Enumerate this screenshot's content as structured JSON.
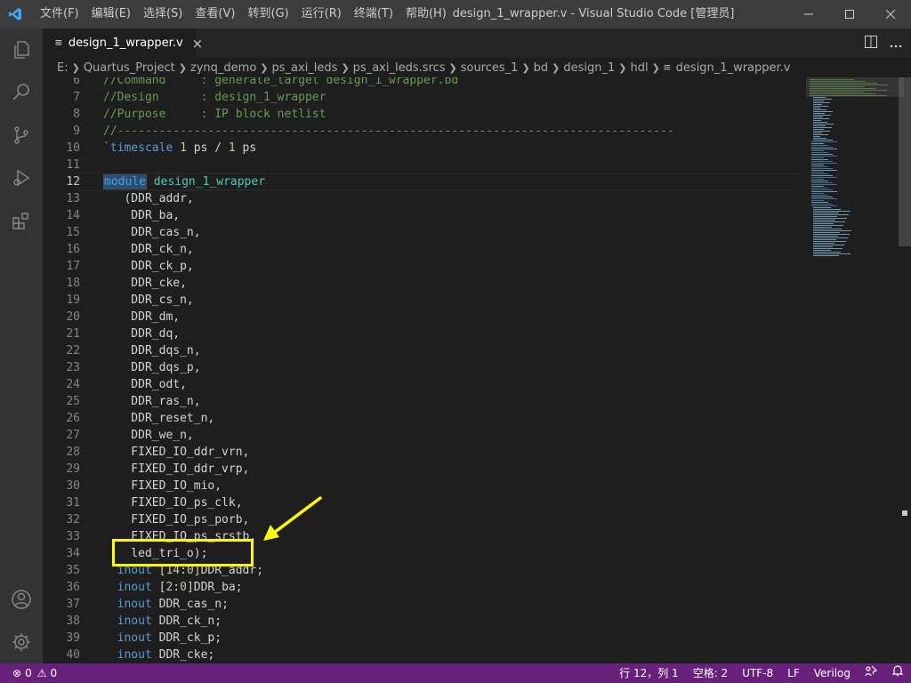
{
  "titlebar": {
    "menu": [
      "文件(F)",
      "编辑(E)",
      "选择(S)",
      "查看(V)",
      "转到(G)",
      "运行(R)",
      "终端(T)",
      "帮助(H)"
    ],
    "window_title": "design_1_wrapper.v - Visual Studio Code [管理员]"
  },
  "tab": {
    "label": "design_1_wrapper.v",
    "icon_text": "≡"
  },
  "breadcrumb": [
    "E:",
    "Quartus_Project",
    "zynq_demo",
    "ps_axi_leds",
    "ps_axi_leds.srcs",
    "sources_1",
    "bd",
    "design_1",
    "hdl",
    "design_1_wrapper.v"
  ],
  "editor": {
    "current_line": 12,
    "lines": [
      {
        "n": "6",
        "t": "//Command     : generate_target design_1_wrapper.bd"
      },
      {
        "n": "7",
        "t": "//Design      : design_1_wrapper"
      },
      {
        "n": "8",
        "t": "//Purpose     : IP block netlist"
      },
      {
        "n": "9",
        "t": "//--------------------------------------------------------------------------------"
      },
      {
        "n": "10",
        "t": "`timescale 1 ps / 1 ps"
      },
      {
        "n": "11",
        "t": ""
      },
      {
        "n": "12",
        "t": "module design_1_wrapper"
      },
      {
        "n": "13",
        "t": "   (DDR_addr,"
      },
      {
        "n": "14",
        "t": "    DDR_ba,"
      },
      {
        "n": "15",
        "t": "    DDR_cas_n,"
      },
      {
        "n": "16",
        "t": "    DDR_ck_n,"
      },
      {
        "n": "17",
        "t": "    DDR_ck_p,"
      },
      {
        "n": "18",
        "t": "    DDR_cke,"
      },
      {
        "n": "19",
        "t": "    DDR_cs_n,"
      },
      {
        "n": "20",
        "t": "    DDR_dm,"
      },
      {
        "n": "21",
        "t": "    DDR_dq,"
      },
      {
        "n": "22",
        "t": "    DDR_dqs_n,"
      },
      {
        "n": "23",
        "t": "    DDR_dqs_p,"
      },
      {
        "n": "24",
        "t": "    DDR_odt,"
      },
      {
        "n": "25",
        "t": "    DDR_ras_n,"
      },
      {
        "n": "26",
        "t": "    DDR_reset_n,"
      },
      {
        "n": "27",
        "t": "    DDR_we_n,"
      },
      {
        "n": "28",
        "t": "    FIXED_IO_ddr_vrn,"
      },
      {
        "n": "29",
        "t": "    FIXED_IO_ddr_vrp,"
      },
      {
        "n": "30",
        "t": "    FIXED_IO_mio,"
      },
      {
        "n": "31",
        "t": "    FIXED_IO_ps_clk,"
      },
      {
        "n": "32",
        "t": "    FIXED_IO_ps_porb,"
      },
      {
        "n": "33",
        "t": "    FIXED_IO_ps_srstb,"
      },
      {
        "n": "34",
        "t": "    led_tri_o);"
      },
      {
        "n": "35",
        "t": "  inout [14:0]DDR_addr;"
      },
      {
        "n": "36",
        "t": "  inout [2:0]DDR_ba;"
      },
      {
        "n": "37",
        "t": "  inout DDR_cas_n;"
      },
      {
        "n": "38",
        "t": "  inout DDR_ck_n;"
      },
      {
        "n": "39",
        "t": "  inout DDR_ck_p;"
      },
      {
        "n": "40",
        "t": "  inout DDR_cke;"
      }
    ]
  },
  "statusbar": {
    "errors": "0",
    "warnings": "0",
    "position": "行 12，列 1",
    "spaces": "空格: 2",
    "encoding": "UTF-8",
    "eol": "LF",
    "language": "Verilog"
  },
  "colors": {
    "statusbar": "#68217a",
    "highlight": "#ffff00",
    "comment": "#6a9955",
    "keyword": "#569cd6",
    "module_name": "#4ec9b0"
  }
}
